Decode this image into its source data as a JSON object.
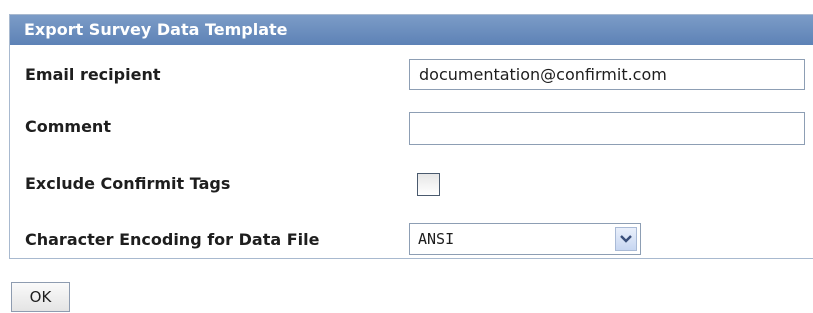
{
  "dialog": {
    "title": "Export Survey Data Template"
  },
  "form": {
    "email_label": "Email recipient",
    "email_value": "documentation@confirmit.com",
    "comment_label": "Comment",
    "comment_value": "",
    "exclude_tags_label": "Exclude Confirmit Tags",
    "exclude_tags_checked": false,
    "encoding_label": "Character Encoding for Data File",
    "encoding_value": "ANSI"
  },
  "actions": {
    "ok_label": "OK"
  },
  "colors": {
    "header_bg": "#6a8cbd",
    "border": "#a8b9cf"
  },
  "icons": {
    "dropdown": "chevron-down-icon"
  }
}
